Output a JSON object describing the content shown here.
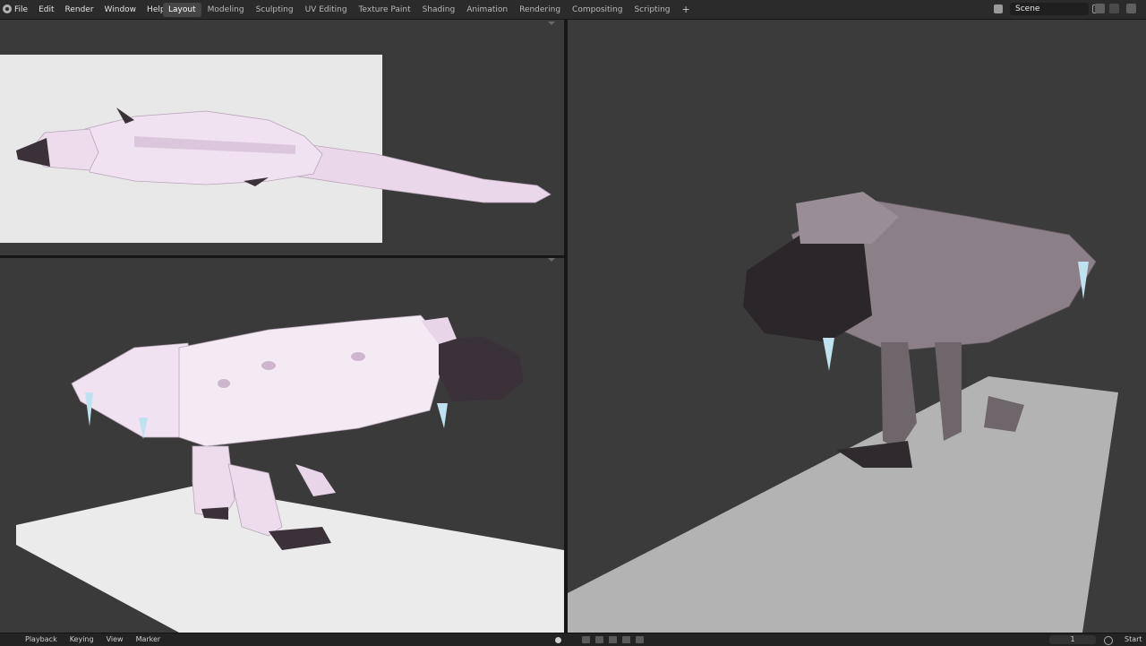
{
  "menu": {
    "items": [
      "File",
      "Edit",
      "Render",
      "Window",
      "Help"
    ]
  },
  "workspaces": {
    "tabs": [
      "Layout",
      "Modeling",
      "Sculpting",
      "UV Editing",
      "Texture Paint",
      "Shading",
      "Animation",
      "Rendering",
      "Compositing",
      "Scripting"
    ],
    "active": "Layout",
    "add": "+"
  },
  "scene": {
    "name": "Scene"
  },
  "timeline": {
    "items": [
      "Playback",
      "Keying",
      "View",
      "Marker"
    ],
    "frame": "1",
    "start_label": "Start"
  },
  "colors": {
    "topbar": "#2b2b2b",
    "viewport_bg": "#3a3a3a",
    "active_tab": "#464646",
    "model_pink": "#efe0ef",
    "model_dark": "#3a3238",
    "ground": "#e8e8e8"
  }
}
